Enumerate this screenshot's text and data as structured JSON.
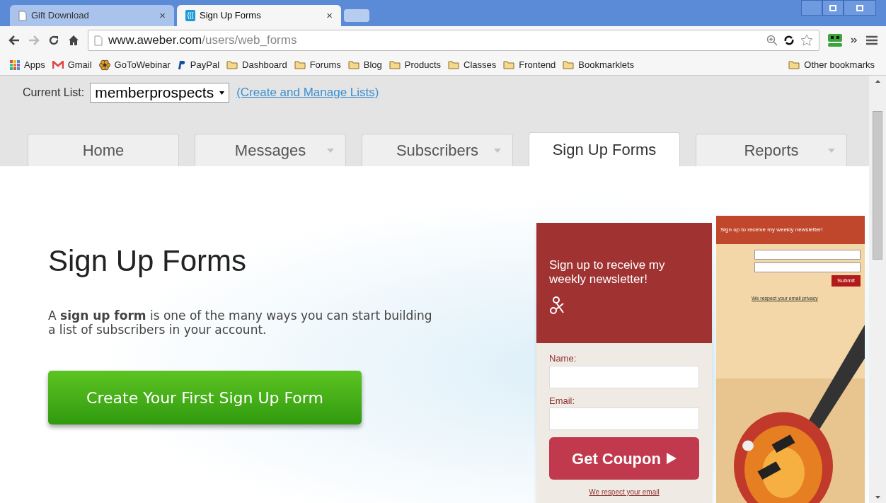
{
  "browser_tabs": [
    {
      "title": "Gift Download",
      "selected": false,
      "close": "×"
    },
    {
      "title": "Sign Up Forms",
      "selected": true,
      "close": "×"
    }
  ],
  "address": {
    "host": "www.aweber.com",
    "path": "/users/web_forms"
  },
  "bookmarks": [
    {
      "label": "Apps",
      "kind": "apps"
    },
    {
      "label": "Gmail",
      "kind": "gmail"
    },
    {
      "label": "GoToWebinar",
      "kind": "flower"
    },
    {
      "label": "PayPal",
      "kind": "paypal"
    },
    {
      "label": "Dashboard",
      "kind": "folder"
    },
    {
      "label": "Forums",
      "kind": "folder"
    },
    {
      "label": "Blog",
      "kind": "folder"
    },
    {
      "label": "Products",
      "kind": "folder"
    },
    {
      "label": "Classes",
      "kind": "folder"
    },
    {
      "label": "Frontend",
      "kind": "folder"
    },
    {
      "label": "Bookmarklets",
      "kind": "folder"
    }
  ],
  "other_bookmarks": "Other bookmarks",
  "list_bar": {
    "label": "Current List:",
    "value": "memberprospects",
    "link": "(Create and Manage Lists)"
  },
  "nav_tabs": [
    {
      "label": "Home",
      "selected": false,
      "has_menu": false
    },
    {
      "label": "Messages",
      "selected": false,
      "has_menu": true
    },
    {
      "label": "Subscribers",
      "selected": false,
      "has_menu": true
    },
    {
      "label": "Sign Up Forms",
      "selected": true,
      "has_menu": false
    },
    {
      "label": "Reports",
      "selected": false,
      "has_menu": true
    }
  ],
  "heading": "Sign Up Forms",
  "intro": "A **sign up form** is one of the many ways you can start building a list of subscribers in your account.",
  "cta": "Create Your First Sign Up Form",
  "preview": {
    "front": {
      "title": "Sign up to receive my weekly newsletter!",
      "fields": [
        "Name:",
        "Email:"
      ],
      "button": "Get Coupon",
      "privacy": "We respect your email"
    },
    "back": {
      "title": "Sign up to receive my weekly newsletter!",
      "button": "Submit",
      "privacy": "We respect your email privacy"
    }
  }
}
